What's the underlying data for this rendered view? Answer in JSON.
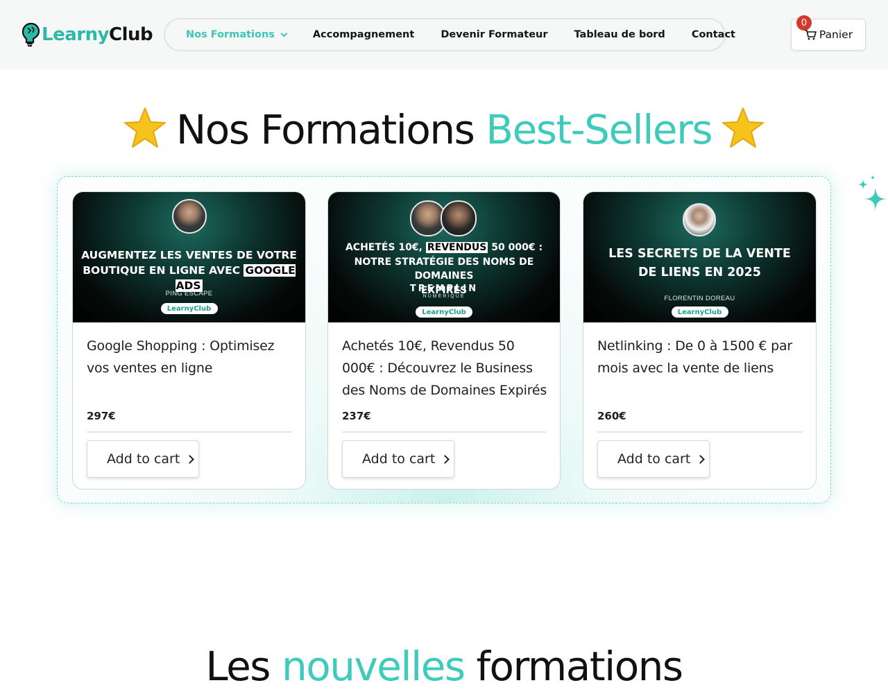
{
  "brand": {
    "logo_part1": "Learny",
    "logo_part2": "Club",
    "accent_color": "#3ecbbb"
  },
  "nav": {
    "items": [
      {
        "label": "Nos Formations",
        "active": true
      },
      {
        "label": "Accompagnement"
      },
      {
        "label": "Devenir Formateur"
      },
      {
        "label": "Tableau de bord"
      },
      {
        "label": "Contact"
      }
    ]
  },
  "cart": {
    "label": "Panier",
    "count": "0",
    "icon": "cart-icon"
  },
  "bestsellers": {
    "title_part1": "Nos Formations",
    "title_part2": "Best-Sellers",
    "icon": "star-icon"
  },
  "products": [
    {
      "thumb_line1": "AUGMENTEZ LES VENTES DE VOTRE",
      "thumb_line2_pre": "BOUTIQUE EN LIGNE AVEC ",
      "thumb_line2_hl": "GOOGLE ADS",
      "thumb_author": "PING ESCAPE",
      "thumb_brand": "LearnyClub",
      "title": "Google Shopping : Optimisez vos ventes en ligne",
      "price": "297€",
      "button": "Add to cart"
    },
    {
      "thumb_line1_pre": "ACHETÉS 10€, ",
      "thumb_line1_hl": "REVENDUS",
      "thumb_line1_post": " 50 000€ :",
      "thumb_line2": "NOTRE STRATÉGIE DES NOMS DE DOMAINES",
      "thumb_line3": "EXPIRÉS",
      "thumb_partner": "TREMPLIN",
      "thumb_partner_sub": "NUMÉRIQUE",
      "thumb_brand": "LearnyClub",
      "title": "Achetés 10€, Revendus 50 000€ : Découvrez le Business des Noms de Domaines Expirés",
      "price": "237€",
      "button": "Add to cart"
    },
    {
      "thumb_line1": "LES SECRETS DE LA VENTE",
      "thumb_line2": "DE LIENS EN 2025",
      "thumb_author": "FLORENTIN DOREAU",
      "thumb_brand": "LearnyClub",
      "title": "Netlinking : De 0 à 1500 € par mois avec la vente de liens",
      "price": "260€",
      "button": "Add to cart"
    }
  ],
  "next_section": {
    "title_part1": "Les ",
    "title_part2": "nouvelles",
    "title_part3": " formations"
  }
}
